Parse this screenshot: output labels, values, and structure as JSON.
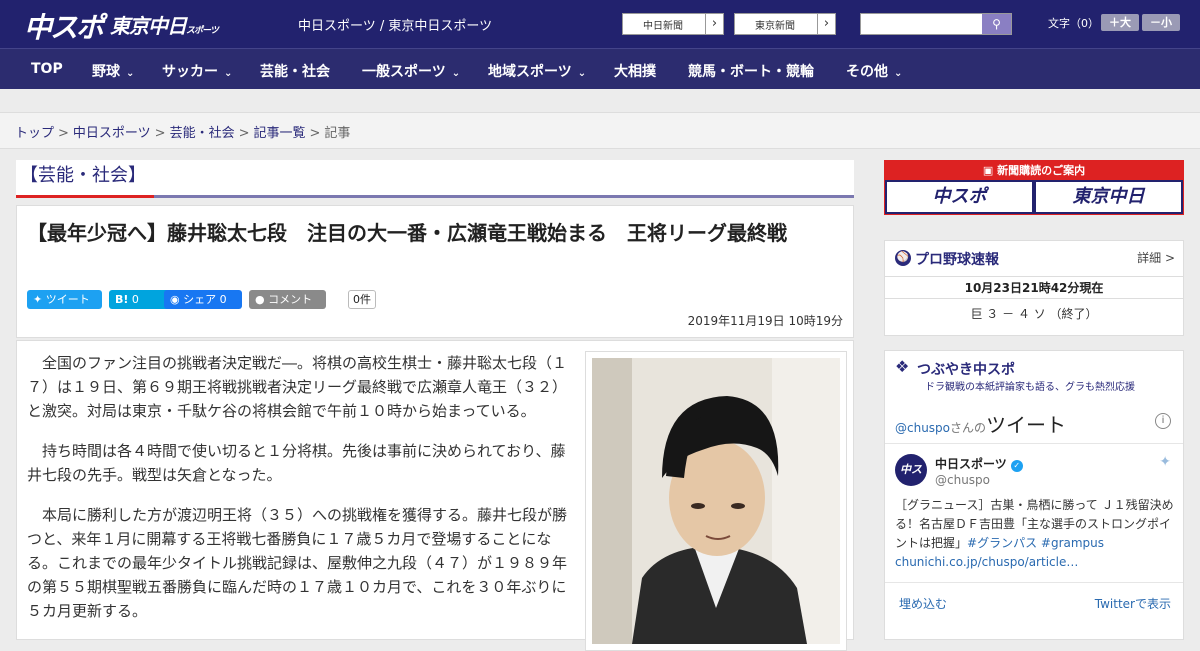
{
  "header": {
    "logo_primary": "中スポ",
    "logo_secondary": "東京中日",
    "logo_secondary_small": "スポーツ",
    "site_name": "中日スポーツ / 東京中日スポーツ",
    "paper_links": [
      "中日新聞",
      "東京新聞"
    ],
    "search_placeholder": "",
    "font_size_label": "文字（0）",
    "font_larger": "＋大",
    "font_smaller": "－小"
  },
  "nav": {
    "items": [
      {
        "label": "TOP",
        "dropdown": false
      },
      {
        "label": "野球",
        "dropdown": true
      },
      {
        "label": "サッカー",
        "dropdown": true
      },
      {
        "label": "芸能・社会",
        "dropdown": false
      },
      {
        "label": "一般スポーツ",
        "dropdown": true
      },
      {
        "label": "地域スポーツ",
        "dropdown": true
      },
      {
        "label": "大相撲",
        "dropdown": false
      },
      {
        "label": "競馬・ボート・競輪",
        "dropdown": false
      },
      {
        "label": "その他",
        "dropdown": true
      }
    ]
  },
  "breadcrumb": [
    "トップ",
    "中日スポーツ",
    "芸能・社会",
    "記事一覧",
    "記事"
  ],
  "article": {
    "category": "【芸能・社会】",
    "title": "【最年少冠へ】藤井聡太七段　注目の大一番・広瀬竜王戦始まる　王将リーグ最終戦",
    "share": {
      "tweet": "ツイート",
      "hatena_count": "0",
      "facebook_share": "シェア",
      "facebook_count": "0",
      "comment": "コメント",
      "comment_count": "0件"
    },
    "date": "2019年11月19日 10時19分",
    "paragraphs": [
      "全国のファン注目の挑戦者決定戦だ―。将棋の高校生棋士・藤井聡太七段（１７）は１９日、第６９期王将戦挑戦者決定リーグ最終戦で広瀬章人竜王（３２）と激突。対局は東京・千駄ケ谷の将棋会館で午前１０時から始まっている。",
      "持ち時間は各４時間で使い切ると１分将棋。先後は事前に決められており、藤井七段の先手。戦型は矢倉となった。",
      "本局に勝利した方が渡辺明王将（３５）への挑戦権を獲得する。藤井七段が勝つと、来年１月に開幕する王将戦七番勝負に１７歳５カ月で登場することになる。これまでの最年少タイトル挑戦記録は、屋敷伸之九段（４７）が１９８９年の第５５期棋聖戦五番勝負に臨んだ時の１７歳１０カ月で、これを３０年ぶりに５カ月更新する。"
    ]
  },
  "sidebar": {
    "subscribe_header": "新聞購読のご案内",
    "subscribe_logo1": "中スポ",
    "subscribe_logo2": "東京中日",
    "baseball": {
      "title": "プロ野球速報",
      "detail": "詳細 >",
      "time": "10月23日21時42分現在",
      "score": "巨 ３ － ４ ソ （終了）"
    },
    "tweets": {
      "title": "つぶやき中スポ",
      "subtitle": "ドラ観戦の本紙評論家も語る、グラも熱烈応援",
      "widget_handle": "@chuspo",
      "widget_san": "さんの",
      "widget_title": "ツイート",
      "account_name": "中日スポーツ",
      "account_handle": "@chuspo",
      "text": "［グラニュース］古巣・鳥栖に勝って Ｊ１残留決める！名古屋ＤＦ吉田豊「主な選手のストロングポイントは把握」",
      "tag1": "#グランパス",
      "tag2": "#grampus",
      "link": "chunichi.co.jp/chuspo/article…",
      "embed": "埋め込む",
      "view_on_twitter": "Twitterで表示"
    }
  },
  "colors": {
    "header_bg": "#22226e",
    "nav_bg": "#2c2c6f",
    "accent_red": "#dd2222",
    "twitter_blue": "#1da1f2",
    "facebook_blue": "#1877f2",
    "hatena_blue": "#00a4de"
  }
}
